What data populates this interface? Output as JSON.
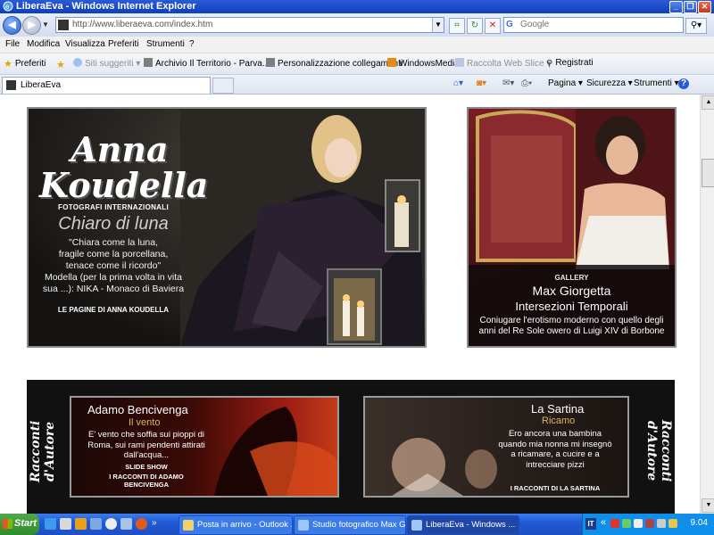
{
  "window": {
    "title": "LiberaEva - Windows Internet Explorer",
    "minimize": "_",
    "restore": "❐",
    "close": "✕"
  },
  "address_bar": {
    "url": "http://www.liberaeva.com/index.htm",
    "search_placeholder": "Google"
  },
  "menu": [
    "File",
    "Modifica",
    "Visualizza",
    "Preferiti",
    "Strumenti",
    "?"
  ],
  "favorites_bar": {
    "favorites_label": "Preferiti",
    "items": [
      {
        "label": "Siti suggeriti ▾"
      },
      {
        "label": "Archivio Il Territorio - Parva..."
      },
      {
        "label": "Personalizzazione collegamenti"
      },
      {
        "label": "WindowsMedia"
      },
      {
        "label": "Raccolta Web Slice ▾"
      },
      {
        "label": "Registrati"
      }
    ]
  },
  "tab": {
    "label": "LiberaEva"
  },
  "command_bar": {
    "page": "Pagina ▾",
    "security": "Sicurezza ▾",
    "tools": "Strumenti ▾",
    "help": "?"
  },
  "banner1": {
    "name_line1": "Anna",
    "name_line2": "Koudella",
    "category": "FOTOGRAFI INTERNAZIONALI",
    "headline": "Chiaro di luna",
    "desc_line1": "\"Chiara come la luna,",
    "desc_line2": "fragile come la porcellana,",
    "desc_line3": "tenace come il ricordo\"",
    "desc_line4": "Modella (per la prima volta in vita",
    "desc_line5": "sua ...): NIKA - Monaco di Baviera",
    "link": "LE PAGINE DI ANNA KOUDELLA"
  },
  "banner2": {
    "category": "GALLERY",
    "headline": "Max Giorgetta",
    "subtitle": "Intersezioni Temporali",
    "desc_line1": "Coniugare l'erotismo moderno con quello degli",
    "desc_line2": "anni del Re Sole owero di Luigi XIV di Borbone"
  },
  "stories": {
    "side_label": "Racconti d'Autore",
    "story1": {
      "title": "Adamo Bencivenga",
      "subtitle": "Il vento",
      "desc_line1": "E' vento che soffia sui pioppi di",
      "desc_line2": "Roma, sui rami pendenti attirati",
      "desc_line3": "dall'acqua...",
      "tag1": "SLIDE SHOW",
      "tag2": "I RACCONTI DI ADAMO",
      "tag3": "BENCIVENGA"
    },
    "story2": {
      "title": "La Sartina",
      "subtitle": "Ricamo",
      "desc_line1": "Ero ancora una bambina",
      "desc_line2": "quando mia nonna mi insegnò",
      "desc_line3": "a ricamare, a cucire e a",
      "desc_line4": "intrecciare pizzi",
      "tag1": "I RACCONTI DI LA SARTINA"
    }
  },
  "taskbar": {
    "start": "Start",
    "tasks": [
      {
        "label": "Posta in arrivo - Outlook ..."
      },
      {
        "label": "Studio fotografico Max G..."
      },
      {
        "label": "LiberaEva - Windows ..."
      }
    ],
    "tray_lang": "IT",
    "tray_chevron": "«",
    "clock": "9.04"
  },
  "colors": {
    "titlebar": "#1040b8",
    "taskbar": "#215ad6",
    "start_button": "#2f8b2c",
    "gold_accent": "#e0b45c"
  }
}
